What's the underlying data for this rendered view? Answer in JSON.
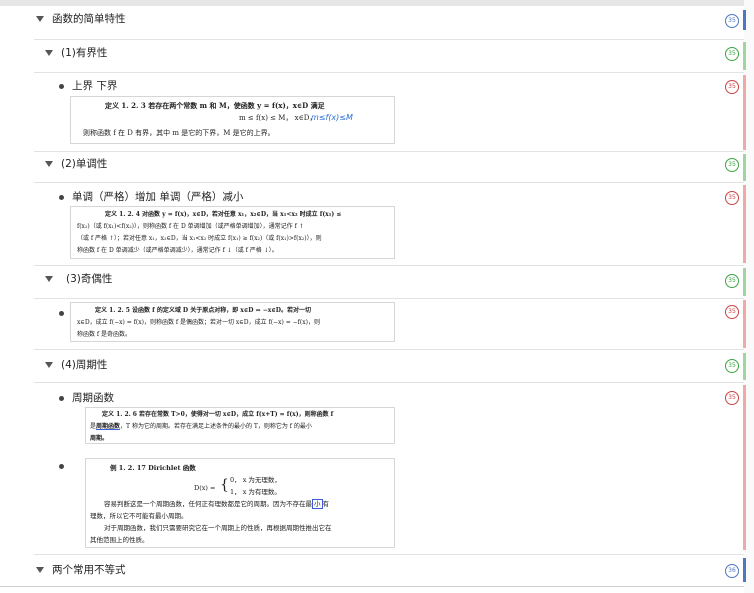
{
  "badge_count": "35",
  "badge_count_last": "36",
  "colors": {
    "blue": "#4a78c4",
    "green": "#3aa544",
    "red": "#c94444",
    "line": "#e3e3e3"
  },
  "nodes": {
    "root": "函数的简单特性",
    "bounded": "(1)有界性",
    "bounded_item": "上界 下界",
    "monotonic": "(2)单调性",
    "monotonic_item": "单调（严格）增加 单调（严格）减小",
    "parity": "(3)奇偶性",
    "periodic": "(4)周期性",
    "periodic_item": "周期函数",
    "inequalities": "两个常用不等式"
  },
  "img1": {
    "l1": "定义 1. 2. 3   若存在两个常数 m 和 M，使函数 y = f(x)，x∈D 满足",
    "l2": "m ≤ f(x) ≤ M，  x∈D，",
    "hand": "m≤f(x)≤M",
    "l3": "则称函数 f 在 D 有界，其中 m 是它的下界，M 是它的上界。"
  },
  "img2": {
    "l1": "定义 1. 2. 4   对函数 y = f(x)，x∈D，若对任意 x₁，x₂∈D，当 x₁<x₂ 时成立 f(x₁) ≤",
    "l2": "f(x₂)（或 f(x₁)<f(x₂)），则称函数 f 在 D 单调增加（或严格单调增加），通常记作 f ↑",
    "l3": "（或 f 严格 ↑）；若对任意 x₁，x₂∈D，当 x₁<x₂ 时成立 f(x₁) ≥ f(x₂)（或 f(x₁)>f(x₂)），则",
    "l4": "称函数 f 在 D 单调减少（或严格单调减少），通常记作 f ↓（或 f 严格 ↓）。"
  },
  "img3": {
    "l1": "定义 1. 2. 5   设函数 f 的定义域 D 关于原点对称，即 x∈D ⇔ −x∈D。若对一切",
    "l2": "x∈D，成立 f(−x) = f(x)，则称函数 f 是偶函数；若对一切 x∈D，成立 f(−x) = −f(x)，则",
    "l3": "称函数 f 是奇函数。"
  },
  "img4": {
    "l1": "定义 1. 2. 6   若存在常数 T>0，使得对一切 x∈D，成立 f(x+T) = f(x)，则称函数 f",
    "l2a": "是",
    "l2u": "周期函数",
    "l2b": "，T 称为它的周期。若存在满足上述条件的最小的 T，则称它为 f 的最小",
    "l3": "周期。"
  },
  "img5": {
    "title": "例 1. 2. 17   Dirichlet 函数",
    "lhs": "D(x) =",
    "c1": "0，   x 为无理数，",
    "c2": "1，   x 为有理数。",
    "p1a": "容易判断这是一个周期函数，任何正有理数都是它的周期。因为不存在最",
    "p1box": "小",
    "p1b": "有",
    "p2": "理数，所以它不可能有最小周期。",
    "p3": "对于周期函数，我们只需要研究它在一个周期上的性质，再根据周期性推出它在",
    "p4": "其他范围上的性质。"
  }
}
